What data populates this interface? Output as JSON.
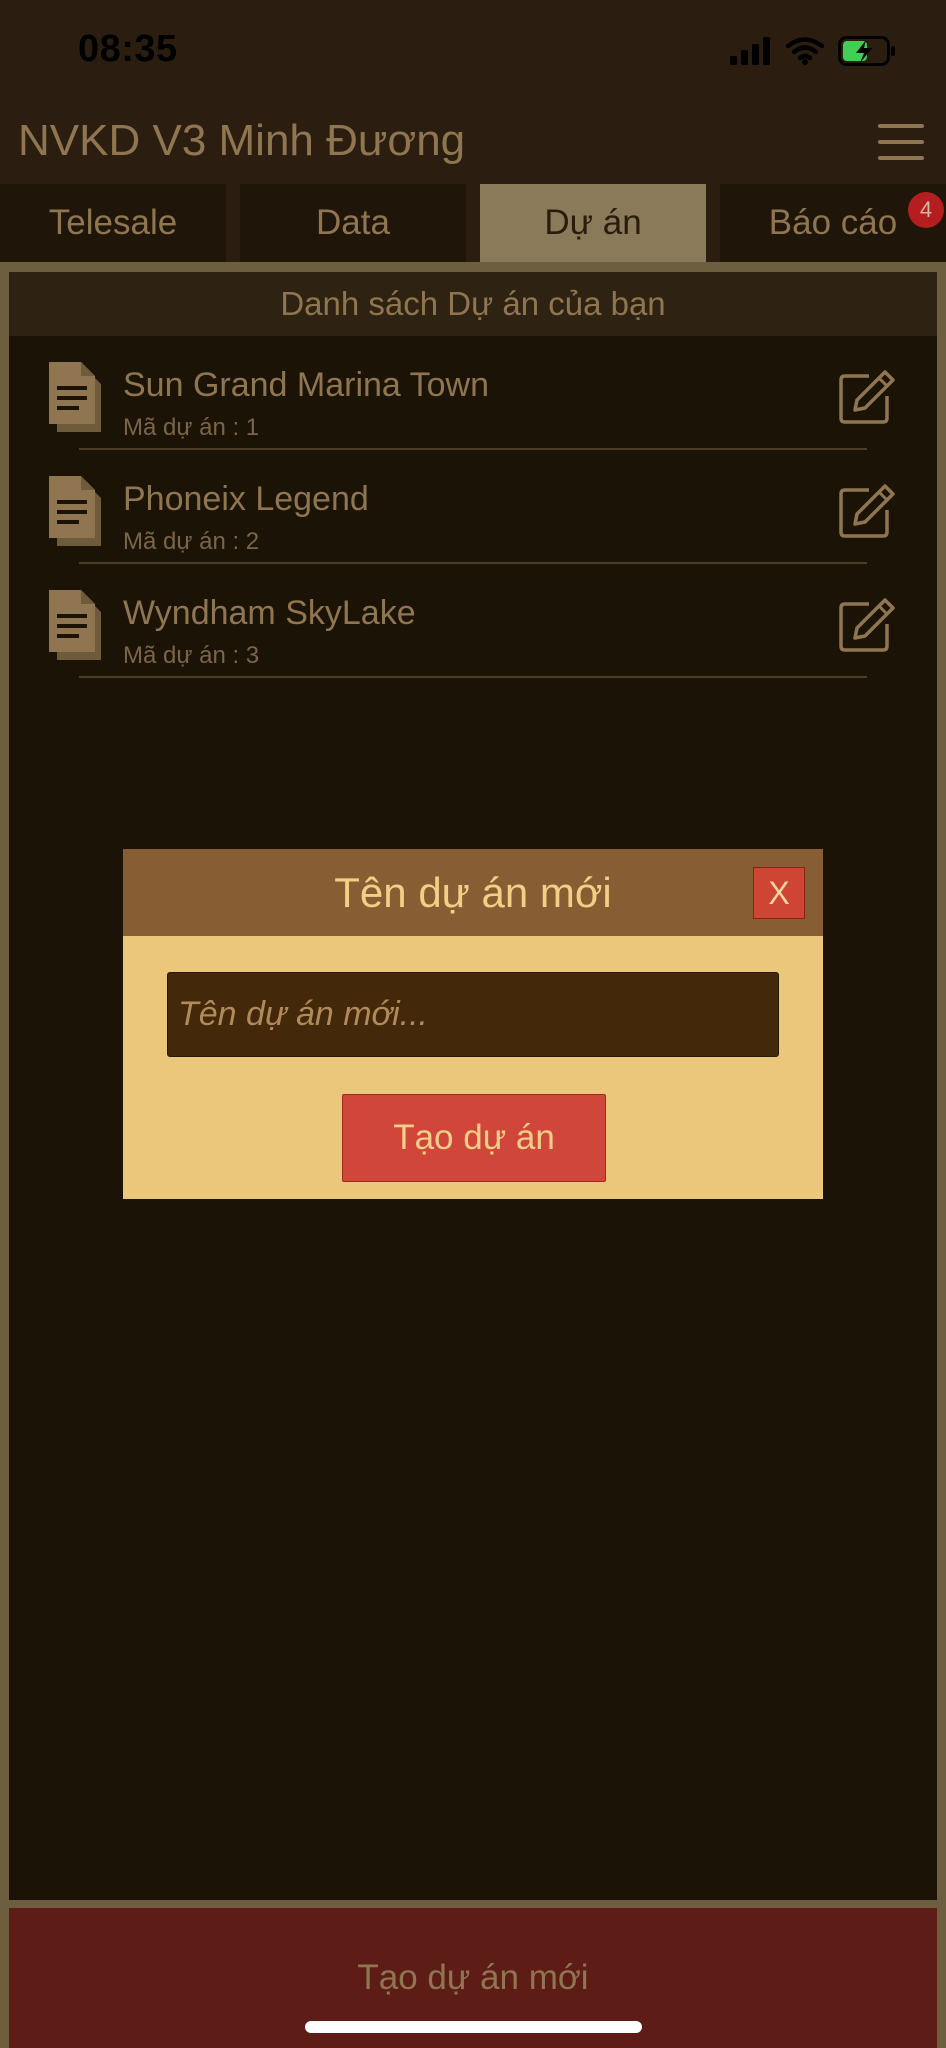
{
  "status_bar": {
    "time": "08:35",
    "icons": [
      "signal-icon",
      "wifi-icon",
      "battery-charging-icon"
    ]
  },
  "header": {
    "title": "NVKD V3 Minh Đương",
    "menu_icon": "hamburger-icon"
  },
  "tabs": [
    {
      "label": "Telesale",
      "active": false
    },
    {
      "label": "Data",
      "active": false
    },
    {
      "label": "Dự án",
      "active": true
    },
    {
      "label": "Báo cáo",
      "active": false,
      "badge": "4"
    }
  ],
  "list": {
    "header": "Danh sách Dự án của bạn",
    "items": [
      {
        "name": "Sun Grand Marina Town",
        "code": "Mã dự án : 1"
      },
      {
        "name": "Phoneix Legend",
        "code": "Mã dự án : 2"
      },
      {
        "name": "Wyndham SkyLake",
        "code": "Mã dự án : 3"
      }
    ]
  },
  "dialog": {
    "title": "Tên dự án mới",
    "close_label": "X",
    "input_placeholder": "Tên dự án mới...",
    "input_value": "",
    "submit_label": "Tạo dự án"
  },
  "footer": {
    "create_label": "Tạo dự án mới"
  },
  "colors": {
    "background": "#1c1307",
    "header": "#2b1e10",
    "text_muted": "#8f7650",
    "dialog_bg": "#ebc77c",
    "dialog_header": "#875e33",
    "accent_red": "#d1463a",
    "footer_button": "#5e1c17",
    "badge": "#b51e1e"
  }
}
